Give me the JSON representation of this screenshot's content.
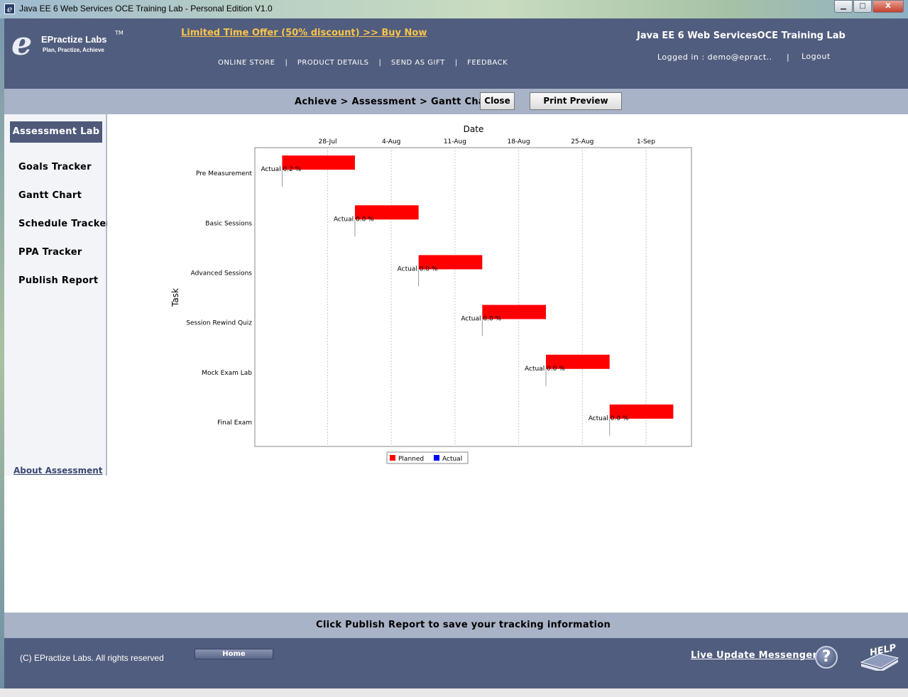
{
  "window": {
    "title": "Java EE 6 Web Services OCE Training Lab - Personal Edition V1.0",
    "app_icon": "e",
    "buttons": {
      "minimize": "▁",
      "maximize": "□",
      "close": "X"
    }
  },
  "header": {
    "logo_letter": "e",
    "brand": "EPractize Labs",
    "trademark": "TM",
    "tagline": "Plan, Practize, Achieve",
    "offer": "Limited Time Offer (50% discount) >> Buy Now",
    "nav": [
      "ONLINE STORE",
      "PRODUCT DETAILS",
      "SEND AS GIFT",
      "FEEDBACK"
    ],
    "nav_sep": "|",
    "app_title": "Java EE 6 Web ServicesOCE Training Lab",
    "login": "Logged in : demo@epract..",
    "sep": "|",
    "logout": "Logout"
  },
  "breadcrumb": {
    "path": "Achieve > Assessment > Gantt Chart",
    "close_label": "Close",
    "print_label": "Print Preview"
  },
  "sidebar": {
    "active": "Assessment Lab",
    "items": [
      "Goals Tracker",
      "Gantt Chart",
      "Schedule Tracker",
      "PPA Tracker",
      "Publish Report"
    ],
    "about": "About Assessment"
  },
  "chart_data": {
    "type": "gantt",
    "xlabel": "Date",
    "ylabel": "Task",
    "x_ticks": [
      "28-Jul",
      "4-Aug",
      "11-Aug",
      "18-Aug",
      "25-Aug",
      "1-Sep"
    ],
    "tasks": [
      {
        "name": "Pre Measurement",
        "planned_start": "2011-07-23",
        "planned_end": "2011-07-31",
        "actual_label": "Actual 0.2 %"
      },
      {
        "name": "Basic Sessions",
        "planned_start": "2011-07-31",
        "planned_end": "2011-08-07",
        "actual_label": "Actual 0.0 %"
      },
      {
        "name": "Advanced Sessions",
        "planned_start": "2011-08-07",
        "planned_end": "2011-08-14",
        "actual_label": "Actual 0.0 %"
      },
      {
        "name": "Session Rewind Quiz",
        "planned_start": "2011-08-14",
        "planned_end": "2011-08-21",
        "actual_label": "Actual 0.0 %"
      },
      {
        "name": "Mock Exam Lab",
        "planned_start": "2011-08-21",
        "planned_end": "2011-08-28",
        "actual_label": "Actual 0.0 %"
      },
      {
        "name": "Final Exam",
        "planned_start": "2011-08-28",
        "planned_end": "2011-09-04",
        "actual_label": "Actual 0.0 %"
      }
    ],
    "legend": [
      {
        "name": "Planned",
        "color": "#ff0000"
      },
      {
        "name": "Actual",
        "color": "#0000ff"
      }
    ],
    "legend_position": "bottom",
    "grid": true
  },
  "status": {
    "message": "Click Publish Report to save your tracking information"
  },
  "footer": {
    "copyright": "(C) EPractize Labs. All rights reserved",
    "home": "Home",
    "live_update": "Live Update Messenger",
    "question_glyph": "?",
    "help": "HELP"
  },
  "colors": {
    "header_bg": "#515d7e",
    "bar_bg": "#a9b3c7",
    "offer": "#f7c44b",
    "planned": "#ff0000",
    "actual": "#0000ff"
  }
}
